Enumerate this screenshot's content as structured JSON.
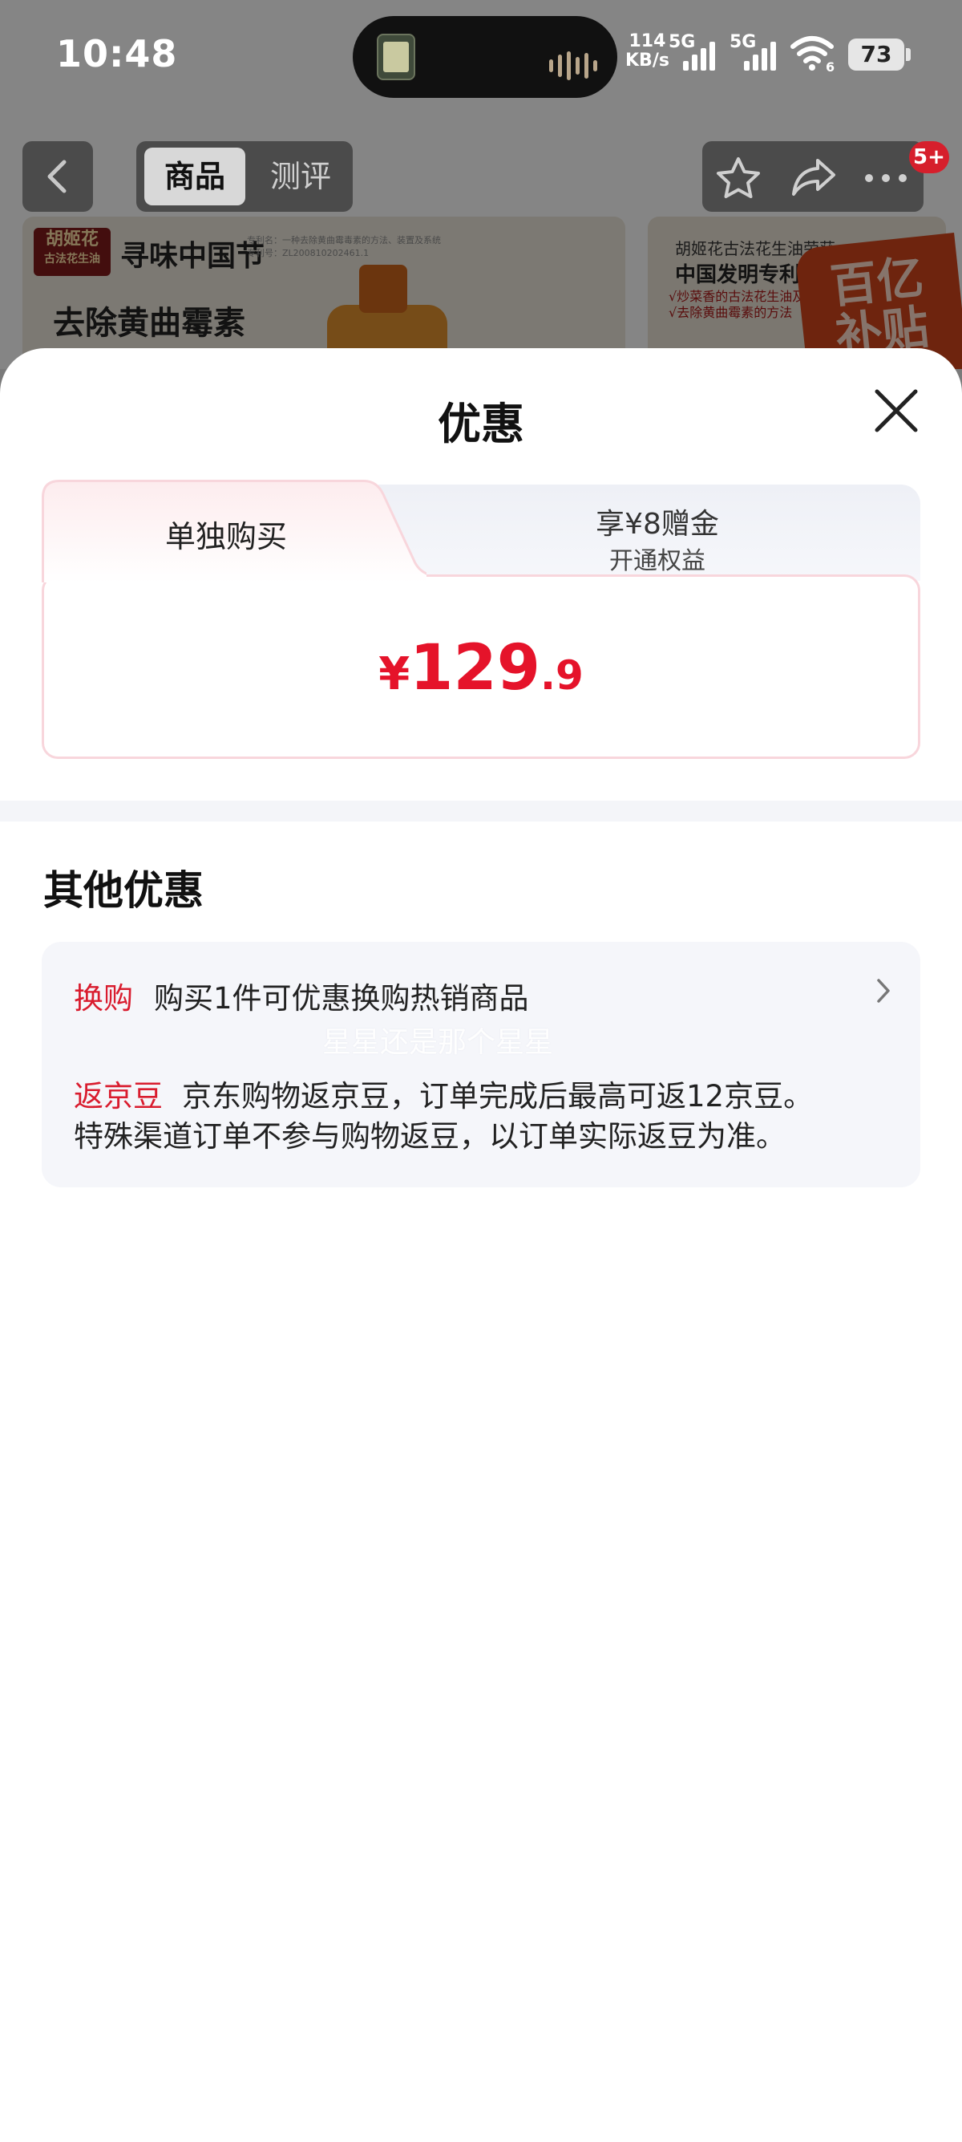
{
  "status_bar": {
    "time": "10:48",
    "net_speed_value": "114",
    "net_speed_unit": "KB/s",
    "sim1": "5G",
    "sim2": "5G",
    "wifi_badge": "6",
    "battery": "73"
  },
  "product_nav": {
    "tab_goods": "商品",
    "tab_review": "测评",
    "message_badge": "5+"
  },
  "banner": {
    "brand": "胡姬花",
    "brand_sub": "古法花生油",
    "slogan": "寻味中国节",
    "fine_print_1": "专利名：一种去除黄曲霉毒素的方法、装置及系统",
    "fine_print_2": "专利号：ZL200810202461.1",
    "headline": "去除黄曲霉素",
    "right_line1": "胡姬花古法花生油荣获",
    "right_line2": "中国发明专利",
    "right_line3a": "√炒菜香的古法花生油及",
    "right_line3b": "√去除黄曲霉素的方法",
    "subsidy": "百亿补贴"
  },
  "sheet": {
    "title": "优惠",
    "tabs": {
      "single_buy": "单独购买",
      "bonus_line1": "享¥8赠金",
      "bonus_line2": "开通权益"
    },
    "price": {
      "currency": "¥",
      "integer": "129",
      "decimal": ".9"
    },
    "other_title": "其他优惠",
    "offers": {
      "swap_tag": "换购",
      "swap_text": "购买1件可优惠换购热销商品",
      "watermark": "星星还是那个星星",
      "bean_tag": "返京豆",
      "bean_text_1": "京东购物返京豆，订单完成后最高可返12京豆。",
      "bean_text_2": "特殊渠道订单不参与购物返豆，以订单实际返豆为准。"
    }
  },
  "colors": {
    "accent_red": "#e5132a",
    "tag_red": "#d91c2e",
    "card_border": "#f8d6dc"
  }
}
